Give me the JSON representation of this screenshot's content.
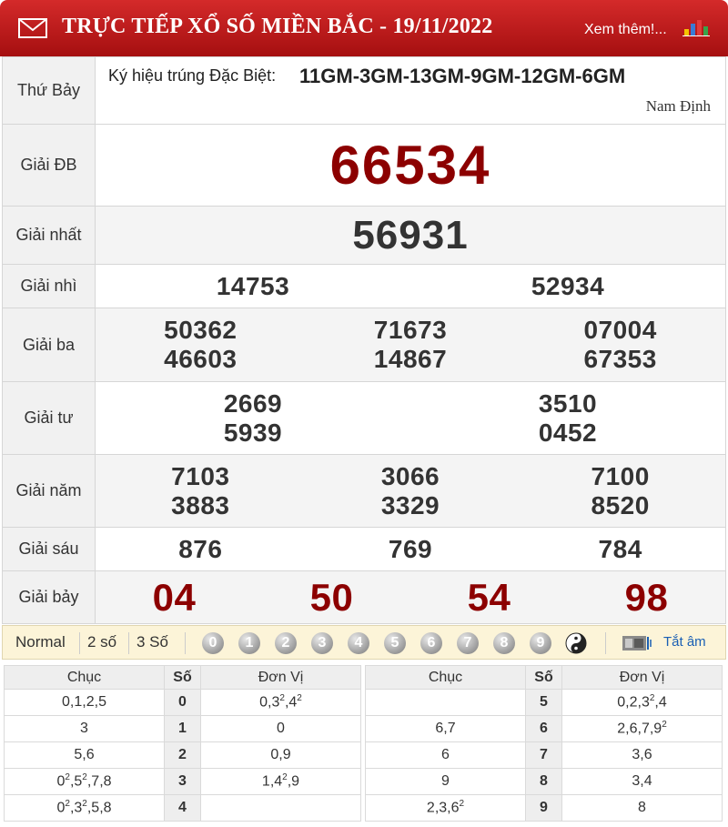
{
  "header": {
    "title": "TRỰC TIẾP XỔ SỐ MIỀN BẮC - 19/11/2022",
    "more_link": "Xem thêm!..."
  },
  "day": "Thứ Bảy",
  "symbol": {
    "label": "Ký hiệu trúng Đặc Biệt:",
    "value": "11GM-3GM-13GM-9GM-12GM-6GM",
    "province": "Nam Định"
  },
  "prizes": {
    "db": {
      "label": "Giải ĐB",
      "numbers": [
        "66534"
      ]
    },
    "nhat": {
      "label": "Giải nhất",
      "numbers": [
        "56931"
      ]
    },
    "nhi": {
      "label": "Giải nhì",
      "numbers": [
        "14753",
        "52934"
      ]
    },
    "ba": {
      "label": "Giải ba",
      "numbers": [
        "50362",
        "71673",
        "07004",
        "46603",
        "14867",
        "67353"
      ]
    },
    "tu": {
      "label": "Giải tư",
      "numbers": [
        "2669",
        "3510",
        "5939",
        "0452"
      ]
    },
    "nam": {
      "label": "Giải năm",
      "numbers": [
        "7103",
        "3066",
        "7100",
        "3883",
        "3329",
        "8520"
      ]
    },
    "sau": {
      "label": "Giải sáu",
      "numbers": [
        "876",
        "769",
        "784"
      ]
    },
    "bay": {
      "label": "Giải bảy",
      "numbers": [
        "04",
        "50",
        "54",
        "98"
      ]
    }
  },
  "filter": {
    "options": [
      "Normal",
      "2 số",
      "3 Số"
    ],
    "digits": [
      "0",
      "1",
      "2",
      "3",
      "4",
      "5",
      "6",
      "7",
      "8",
      "9"
    ],
    "mute_label": "Tắt âm"
  },
  "loto": {
    "headers": {
      "chuc": "Chục",
      "so": "Số",
      "donvi": "Đơn Vị"
    },
    "left": [
      {
        "chuc": "0,1,2,5",
        "so": "0",
        "donvi": "0,3²,4²"
      },
      {
        "chuc": "3",
        "so": "1",
        "donvi": "0"
      },
      {
        "chuc": "5,6",
        "so": "2",
        "donvi": "0,9"
      },
      {
        "chuc": "0²,5²,7,8",
        "so": "3",
        "donvi": "1,4²,9"
      },
      {
        "chuc": "0²,3²,5,8",
        "so": "4",
        "donvi": ""
      }
    ],
    "right": [
      {
        "chuc": "",
        "so": "5",
        "donvi": "0,2,3²,4"
      },
      {
        "chuc": "6,7",
        "so": "6",
        "donvi": "2,6,7,9²"
      },
      {
        "chuc": "6",
        "so": "7",
        "donvi": "3,6"
      },
      {
        "chuc": "9",
        "so": "8",
        "donvi": "3,4"
      },
      {
        "chuc": "2,3,6²",
        "so": "9",
        "donvi": "8"
      }
    ]
  },
  "colors": {
    "header_red": "#c41e1e",
    "jackpot_red": "#8c0000",
    "filter_bg": "#fcf4d8",
    "link_blue": "#1a5fb4"
  }
}
